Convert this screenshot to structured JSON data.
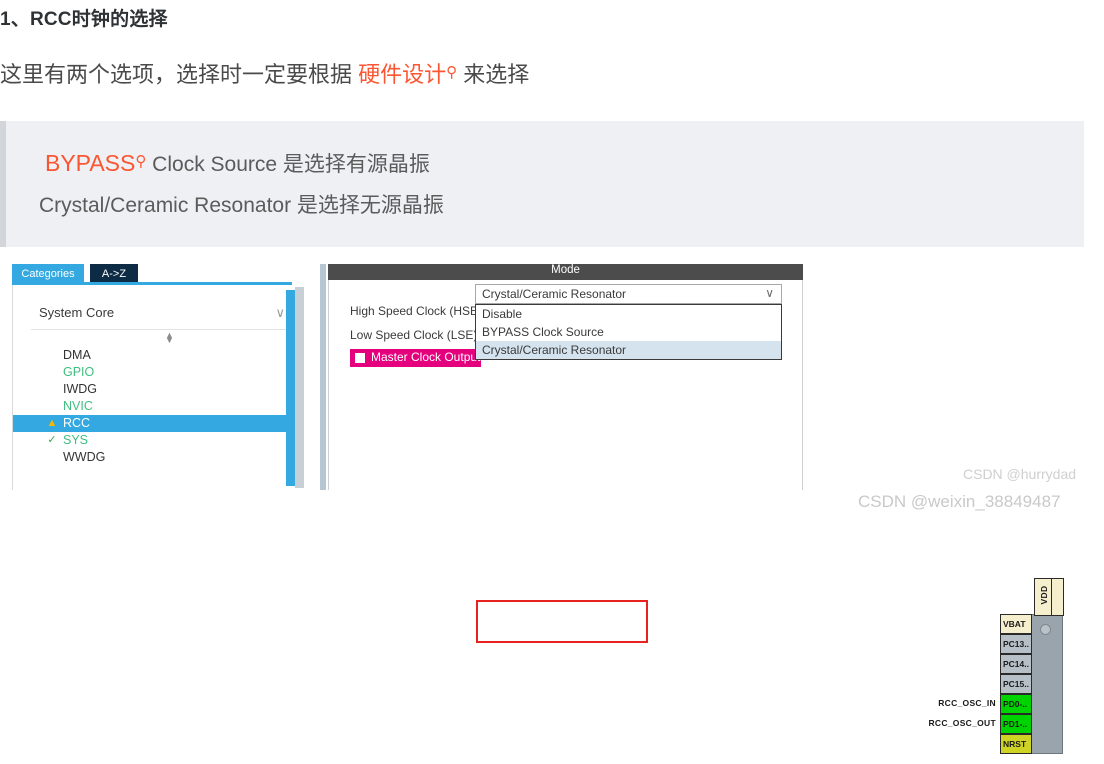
{
  "article": {
    "heading": "1、RCC时钟的选择",
    "paragraph": {
      "before": "这里有两个选项，选择时一定要根据 ",
      "keyword": "硬件设计",
      "magnifier_icon": "search-icon",
      "after": " 来选择"
    },
    "quote": {
      "line1_keyword": "BYPASS",
      "line1_magnifier_icon": "search-icon",
      "line1_rest": " Clock Source 是选择有源晶振",
      "line2": "Crystal/Ceramic Resonator 是选择无源晶振"
    }
  },
  "cubemx": {
    "sidebar": {
      "tabs": [
        {
          "label": "Categories",
          "active": true
        },
        {
          "label": "A->Z",
          "active": false
        }
      ],
      "group": {
        "label": "System Core",
        "chevron_icon": "chevron-down-icon"
      },
      "spinner_icon": "up-down-spinner-icon",
      "peripherals": [
        {
          "label": "DMA",
          "badge": "",
          "state": "default"
        },
        {
          "label": "GPIO",
          "badge": "",
          "state": "configured"
        },
        {
          "label": "IWDG",
          "badge": "",
          "state": "default"
        },
        {
          "label": "NVIC",
          "badge": "",
          "state": "configured"
        },
        {
          "label": "RCC",
          "badge": "warning-icon",
          "state": "selected"
        },
        {
          "label": "SYS",
          "badge": "check-icon",
          "state": "configured"
        },
        {
          "label": "WWDG",
          "badge": "",
          "state": "default"
        }
      ]
    },
    "mode_panel": {
      "title": "Mode",
      "fields": [
        {
          "label": "High Speed Clock (HSE)",
          "value": "Crystal/Ceramic Resonator"
        },
        {
          "label": "Low Speed Clock (LSE)",
          "value": ""
        }
      ],
      "dropdown_arrow_icon": "chevron-down-icon",
      "dropdown_options": [
        {
          "label": "Disable",
          "highlighted": false
        },
        {
          "label": "BYPASS Clock Source",
          "highlighted": false
        },
        {
          "label": "Crystal/Ceramic Resonator",
          "highlighted": true
        }
      ],
      "checkbox": {
        "label": "Master Clock Output",
        "checked": false,
        "highlight_color": "#e5007d"
      }
    },
    "annotation": {
      "color": "#e8231f"
    }
  },
  "chip": {
    "pins": [
      {
        "label": "VDD",
        "orientation": "vertical",
        "color": "#f5efce"
      },
      {
        "label": "VBAT",
        "orientation": "horizontal",
        "color": "#f5efce"
      },
      {
        "label": "PC13..",
        "orientation": "horizontal",
        "color": "#b8c0c7"
      },
      {
        "label": "PC14..",
        "orientation": "horizontal",
        "color": "#b8c0c7"
      },
      {
        "label": "PC15..",
        "orientation": "horizontal",
        "color": "#b8c0c7"
      },
      {
        "label": "PD0-..",
        "orientation": "horizontal",
        "color": "#00d400"
      },
      {
        "label": "PD1-..",
        "orientation": "horizontal",
        "color": "#00d400"
      },
      {
        "label": "NRST",
        "orientation": "horizontal",
        "color": "#cfd424"
      }
    ],
    "signal_labels": [
      "RCC_OSC_IN",
      "RCC_OSC_OUT"
    ]
  },
  "watermarks": {
    "inner": "CSDN @hurrydad",
    "bottom": "CSDN @weixin_38849487"
  }
}
